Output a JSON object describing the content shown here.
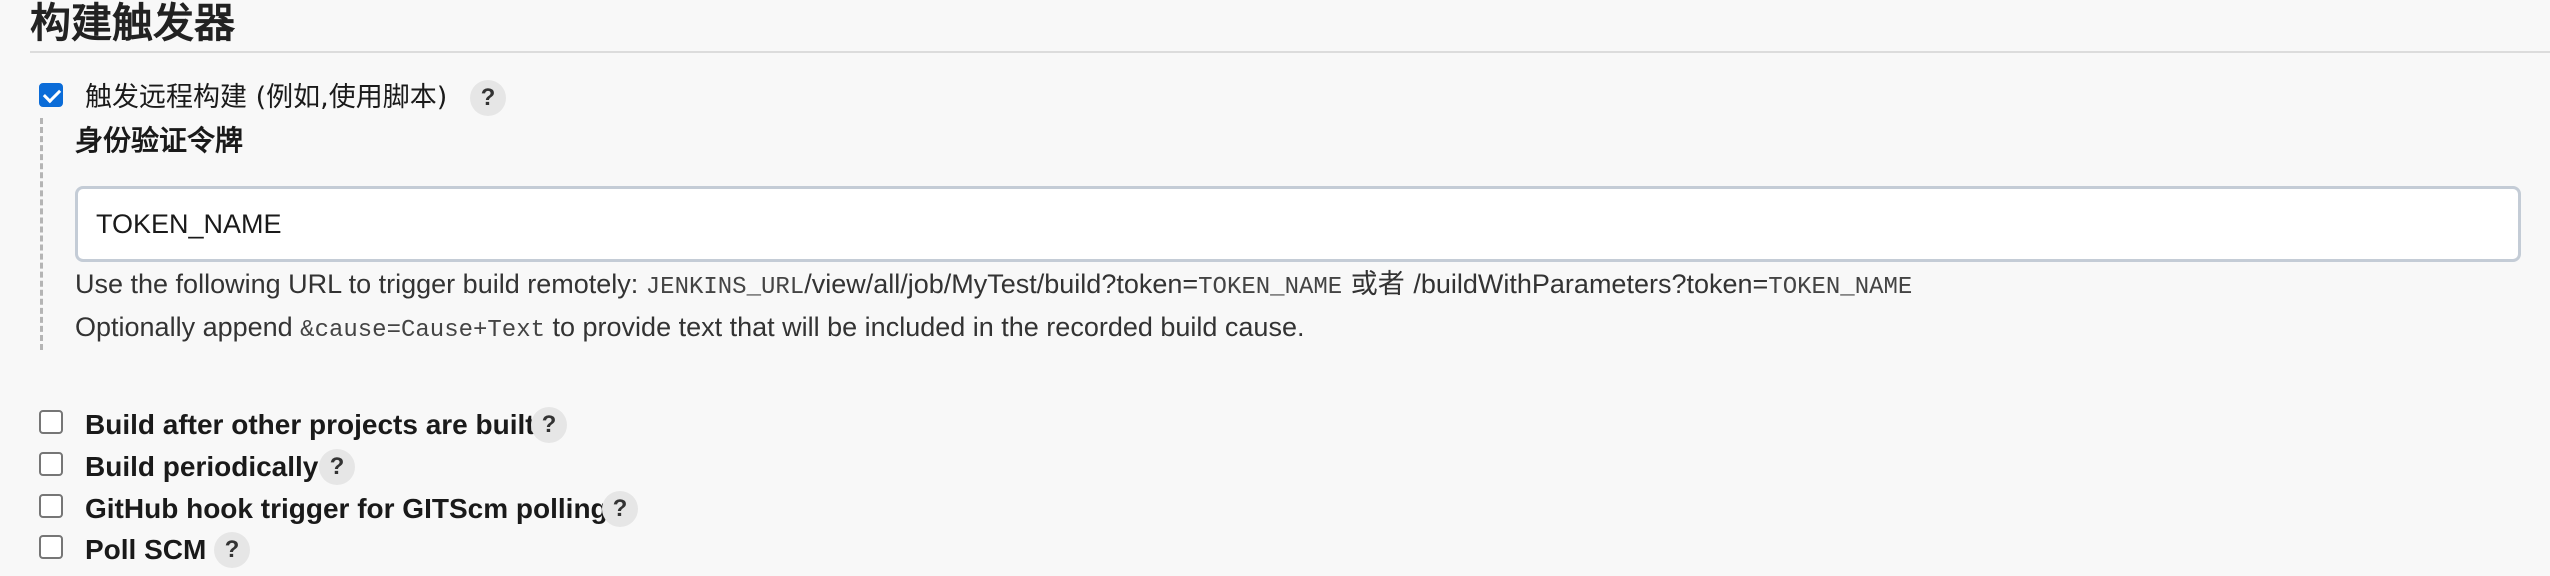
{
  "section": {
    "title": "构建触发器"
  },
  "remote_trigger": {
    "label": "触发远程构建 (例如,使用脚本)",
    "checked": true,
    "help": "?",
    "token_label": "身份验证令牌",
    "token_value": "TOKEN_NAME",
    "url_line": {
      "prefix": "Use the following URL to trigger build remotely: ",
      "jenkins_url": "JENKINS_URL",
      "path": "/view/all/job/MyTest/build?token=",
      "token1": "TOKEN_NAME",
      "or": " 或者 ",
      "path2": "/buildWithParameters?token=",
      "token2": "TOKEN_NAME"
    },
    "cause_line": {
      "prefix": "Optionally append ",
      "code": "&cause=Cause+Text",
      "suffix": " to provide text that will be included in the recorded build cause."
    }
  },
  "triggers": [
    {
      "label": "Build after other projects are built",
      "checked": false,
      "help": "?"
    },
    {
      "label": "Build periodically",
      "checked": false,
      "help": "?"
    },
    {
      "label": "GitHub hook trigger for GITScm polling",
      "checked": false,
      "help": "?"
    },
    {
      "label": "Poll SCM",
      "checked": false,
      "help": "?"
    }
  ],
  "colors": {
    "accent": "#0b6cd8",
    "help_bg": "#e6e6e6"
  }
}
